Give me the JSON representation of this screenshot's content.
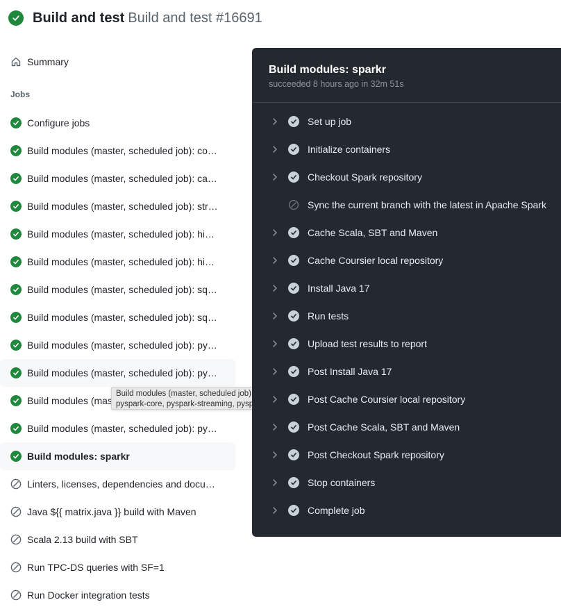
{
  "header": {
    "workflow_name": "Build and test",
    "run_title": "Build and test #16691",
    "status": "success"
  },
  "sidebar": {
    "summary_label": "Summary",
    "jobs_heading": "Jobs",
    "jobs": [
      {
        "label": "Configure jobs",
        "status": "success"
      },
      {
        "label": "Build modules (master, scheduled job): co…",
        "status": "success"
      },
      {
        "label": "Build modules (master, scheduled job): ca…",
        "status": "success"
      },
      {
        "label": "Build modules (master, scheduled job): str…",
        "status": "success"
      },
      {
        "label": "Build modules (master, scheduled job): hi…",
        "status": "success"
      },
      {
        "label": "Build modules (master, scheduled job): hi…",
        "status": "success"
      },
      {
        "label": "Build modules (master, scheduled job): sq…",
        "status": "success"
      },
      {
        "label": "Build modules (master, scheduled job): sq…",
        "status": "success"
      },
      {
        "label": "Build modules (master, scheduled job): py…",
        "status": "success"
      },
      {
        "label": "Build modules (master, scheduled job): py…",
        "status": "success"
      },
      {
        "label": "Build modules (mas",
        "status": "success"
      },
      {
        "label": "Build modules (master, scheduled job): py…",
        "status": "success"
      },
      {
        "label": "Build modules: sparkr",
        "status": "success"
      },
      {
        "label": "Linters, licenses, dependencies and docu…",
        "status": "skipped"
      },
      {
        "label": "Java ${{ matrix.java }} build with Maven",
        "status": "skipped"
      },
      {
        "label": "Scala 2.13 build with SBT",
        "status": "skipped"
      },
      {
        "label": "Run TPC-DS queries with SF=1",
        "status": "skipped"
      },
      {
        "label": "Run Docker integration tests",
        "status": "skipped"
      }
    ]
  },
  "tooltip": {
    "line1": "Build modules (master, scheduled job):",
    "line2": "pyspark-core, pyspark-streaming, pyspark-ml"
  },
  "job_panel": {
    "title": "Build modules: sparkr",
    "subtitle": "succeeded 8 hours ago in 32m 51s",
    "steps": [
      {
        "label": "Set up job",
        "status": "success"
      },
      {
        "label": "Initialize containers",
        "status": "success"
      },
      {
        "label": "Checkout Spark repository",
        "status": "success"
      },
      {
        "label": "Sync the current branch with the latest in Apache Spark",
        "status": "skipped"
      },
      {
        "label": "Cache Scala, SBT and Maven",
        "status": "success"
      },
      {
        "label": "Cache Coursier local repository",
        "status": "success"
      },
      {
        "label": "Install Java 17",
        "status": "success"
      },
      {
        "label": "Run tests",
        "status": "success"
      },
      {
        "label": "Upload test results to report",
        "status": "success"
      },
      {
        "label": "Post Install Java 17",
        "status": "success"
      },
      {
        "label": "Post Cache Coursier local repository",
        "status": "success"
      },
      {
        "label": "Post Cache Scala, SBT and Maven",
        "status": "success"
      },
      {
        "label": "Post Checkout Spark repository",
        "status": "success"
      },
      {
        "label": "Stop containers",
        "status": "success"
      },
      {
        "label": "Complete job",
        "status": "success"
      }
    ]
  },
  "colors": {
    "success": "#1f883d",
    "panel_bg": "#24292f",
    "muted": "#59636e"
  }
}
